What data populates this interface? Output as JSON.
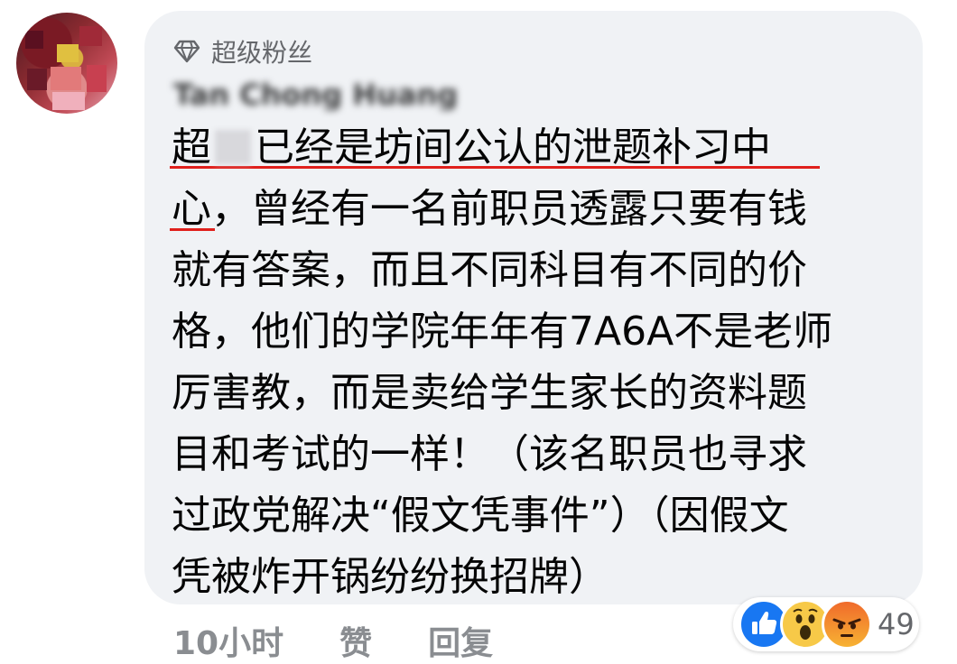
{
  "badge": {
    "label": "超级粉丝",
    "icon": "diamond-icon"
  },
  "author": {
    "name": "Tan Chong Huang"
  },
  "comment": {
    "lines": [
      [
        "超",
        "已经是坊间公认的泄题补习中"
      ],
      "心，曾经有一名前职员透露只要有钱",
      "就有答案，而且不同科目有不同的价",
      "格，他们的学院年年有7A6A不是老师",
      "厉害教，而是卖给学生家长的资料题",
      "目和考试的一样！（该名职员也寻求",
      "过政党解决“假文凭事件”）（因假文",
      "凭被炸开锅纷纷换招牌）"
    ]
  },
  "actions": {
    "time": "10小时",
    "like": "赞",
    "reply": "回复"
  },
  "reactions": {
    "icons": [
      "like-icon",
      "wow-icon",
      "angry-icon"
    ],
    "count": "49"
  },
  "colors": {
    "bubble": "#f0f2f5",
    "underline": "#e0201c",
    "like_blue": "#1877f2"
  }
}
